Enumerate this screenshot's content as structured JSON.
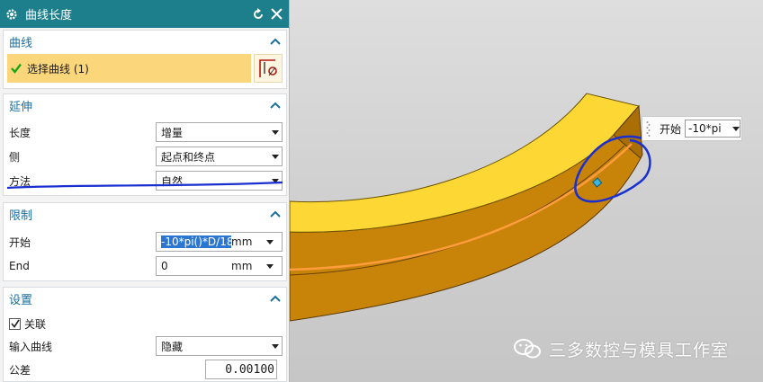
{
  "dialog": {
    "title": "曲线长度",
    "icons": {
      "settings": "gear-icon",
      "reset": "reset-icon",
      "close": "close-icon"
    }
  },
  "curve_group": {
    "header": "曲线",
    "select_label": "选择曲线 (1)"
  },
  "extend_group": {
    "header": "延伸",
    "length_label": "长度",
    "length_value": "增量",
    "side_label": "侧",
    "side_value": "起点和终点",
    "method_label": "方法",
    "method_value": "自然"
  },
  "limits_group": {
    "header": "限制",
    "start_label": "开始",
    "start_value": "-10*pi()*D/18",
    "start_unit": "mm",
    "end_label": "End",
    "end_value": "0",
    "end_unit": "mm"
  },
  "settings_group": {
    "header": "设置",
    "associative_label": "关联",
    "associative_checked": true,
    "input_curve_label": "输入曲线",
    "input_curve_value": "隐藏",
    "tolerance_label": "公差",
    "tolerance_value": "0.00100"
  },
  "float_input": {
    "label": "开始",
    "value": "-10*pi"
  },
  "watermark": {
    "text": "三多数控与模具工作室"
  },
  "colors": {
    "title_bar": "#1d7f8c",
    "group_header": "#1b6f9e",
    "selection_fill": "#fcd67a",
    "part_top": "#fdd835",
    "part_side": "#c9860a",
    "curve": "#ff9d3c",
    "annotation": "#1a2fd0"
  }
}
